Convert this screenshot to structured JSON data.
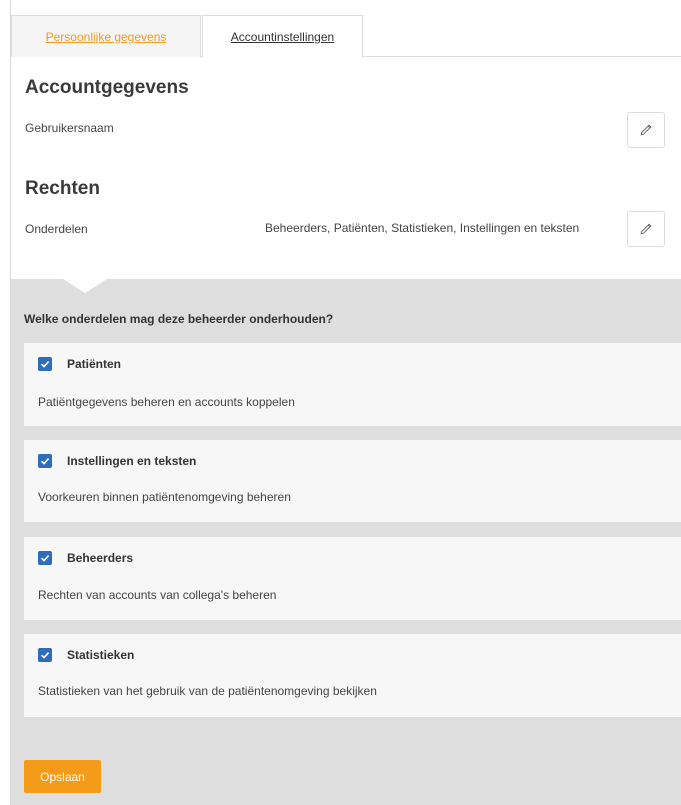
{
  "tabs": [
    {
      "label": "Persoonlijke gegevens"
    },
    {
      "label": "Accountinstellingen"
    }
  ],
  "account": {
    "title": "Accountgegevens",
    "username_label": "Gebruikersnaam"
  },
  "rights": {
    "title": "Rechten",
    "label": "Onderdelen",
    "value": "Beheerders, Patiënten, Statistieken, Instellingen en teksten"
  },
  "permissions": {
    "question": "Welke onderdelen mag deze beheerder onderhouden?",
    "items": [
      {
        "title": "Patiënten",
        "description": "Patiëntgegevens beheren en accounts koppelen",
        "checked": true
      },
      {
        "title": "Instellingen en teksten",
        "description": "Voorkeuren binnen patiëntenomgeving beheren",
        "checked": true
      },
      {
        "title": "Beheerders",
        "description": "Rechten van accounts van collega's beheren",
        "checked": true
      },
      {
        "title": "Statistieken",
        "description": "Statistieken van het gebruik van de patiëntenomgeving bekijken",
        "checked": true
      }
    ]
  },
  "save_label": "Opslaan",
  "colors": {
    "accent": "#f49b1a",
    "checkbox": "#2f6dbb",
    "panel": "#dedede"
  }
}
